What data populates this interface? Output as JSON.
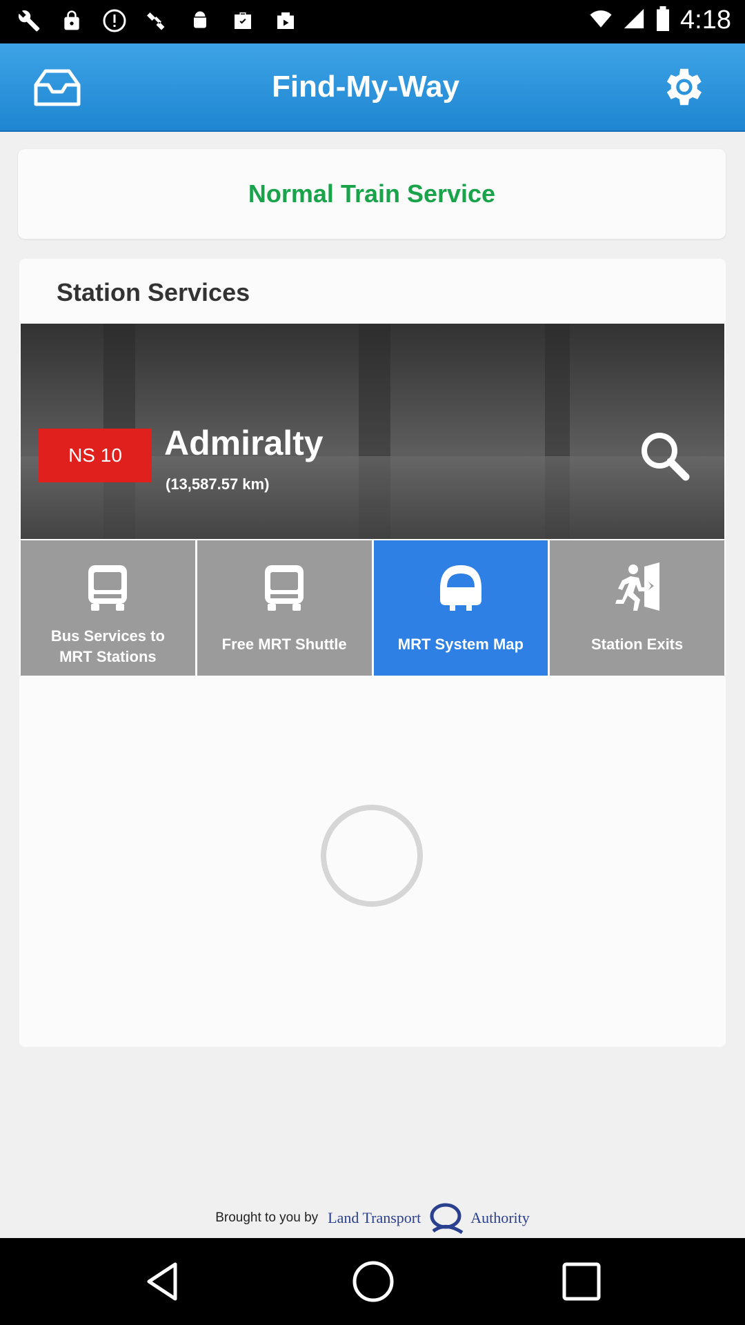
{
  "status_bar": {
    "time": "4:18",
    "icons": [
      "wrench-icon",
      "lock-icon",
      "alert-icon",
      "satellite-icon",
      "android-icon",
      "briefcase-check-icon",
      "play-store-icon"
    ]
  },
  "app_bar": {
    "title": "Find-My-Way"
  },
  "service_status": {
    "text": "Normal Train Service",
    "color": "#1aa34a"
  },
  "station_services": {
    "heading": "Station Services",
    "station": {
      "code": "NS 10",
      "name": "Admiralty",
      "distance": "(13,587.57 km)"
    },
    "tiles": [
      {
        "label_line1": "Bus Services to",
        "label_line2": "MRT Stations",
        "icon": "bus-icon",
        "active": false
      },
      {
        "label": "Free MRT Shuttle",
        "icon": "shuttle-bus-icon",
        "active": false
      },
      {
        "label": "MRT System Map",
        "icon": "train-icon",
        "active": true
      },
      {
        "label": "Station Exits",
        "icon": "exit-icon",
        "active": false
      }
    ]
  },
  "footer": {
    "brought_by": "Brought to you by",
    "org_left": "Land Transport",
    "org_right": "Authority"
  },
  "colors": {
    "app_bar": "#1e86d2",
    "active_tile": "#2e80e4",
    "inactive_tile": "#9b9b9b",
    "station_badge": "#e0201c"
  }
}
